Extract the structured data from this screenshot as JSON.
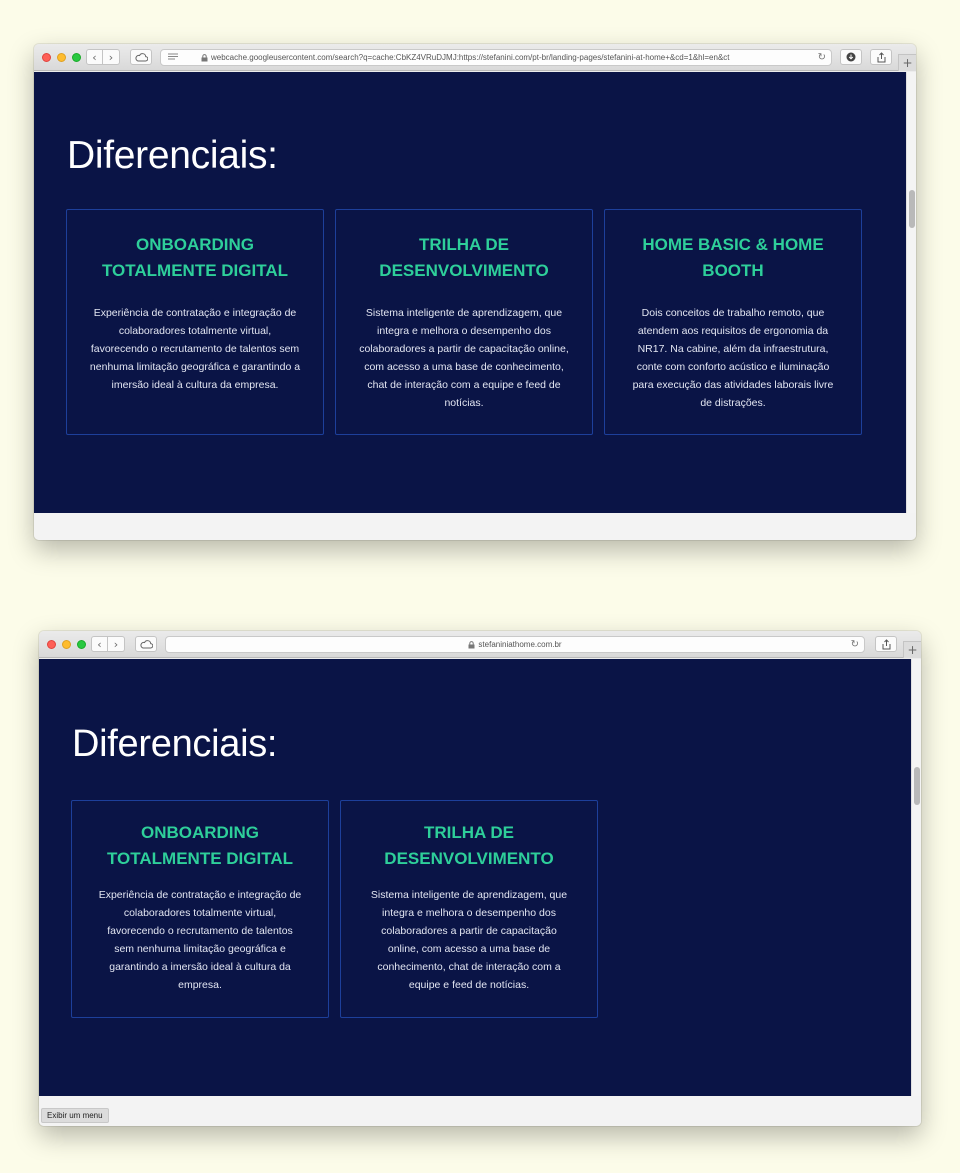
{
  "window1": {
    "url": "webcache.googleusercontent.com/search?q=cache:CbKZ4VRuDJMJ:https://stefanini.com/pt-br/landing-pages/stefanini-at-home+&cd=1&hl=en&ct",
    "heading": "Diferenciais:",
    "cards": [
      {
        "title_line1": "ONBOARDING",
        "title_line2": "TOTALMENTE DIGITAL",
        "text": "Experiência de contratação e integração de colaboradores totalmente virtual, favorecendo o recrutamento de talentos sem nenhuma limitação geográfica e garantindo a imersão ideal à cultura da empresa."
      },
      {
        "title_line1": "TRILHA DE",
        "title_line2": "DESENVOLVIMENTO",
        "text": "Sistema inteligente de aprendizagem, que integra e melhora o desempenho dos colaboradores a partir de capacitação online, com acesso a uma base de conhecimento, chat de interação com a equipe e feed de notícias."
      },
      {
        "title_line1": "HOME BASIC & HOME",
        "title_line2": "BOOTH",
        "text": "Dois conceitos de trabalho remoto, que atendem aos requisitos de ergonomia da NR17. Na cabine, além da infraestrutura, conte com conforto acústico e iluminação para execução das atividades laborais livre de distrações."
      }
    ]
  },
  "window2": {
    "url": "stefaniniathome.com.br",
    "heading": "Diferenciais:",
    "cards": [
      {
        "title_line1": "ONBOARDING",
        "title_line2": "TOTALMENTE DIGITAL",
        "text": "Experiência de contratação e integração de colaboradores totalmente virtual, favorecendo o recrutamento de talentos sem nenhuma limitação geográfica e garantindo a imersão ideal à cultura da empresa."
      },
      {
        "title_line1": "TRILHA DE",
        "title_line2": "DESENVOLVIMENTO",
        "text": "Sistema inteligente de aprendizagem, que integra e melhora o desempenho dos colaboradores a partir de capacitação online, com acesso a uma base de conhecimento, chat de interação com a equipe e feed de notícias."
      }
    ],
    "status_menu": "Exibir um menu"
  },
  "icons": {
    "back": "chevron-left-icon",
    "forward": "chevron-right-icon",
    "cloud": "icloud-tabs-icon",
    "reader": "reader-icon",
    "lock": "lock-icon",
    "reload": "reload-icon",
    "download": "download-icon",
    "share": "share-icon",
    "new_tab": "plus-icon"
  },
  "colors": {
    "page_bg": "#fcfce9",
    "content_bg": "#0a1446",
    "card_title": "#2ecf9a",
    "card_border": "#1d3f9a",
    "card_text": "#e3e6f2"
  }
}
